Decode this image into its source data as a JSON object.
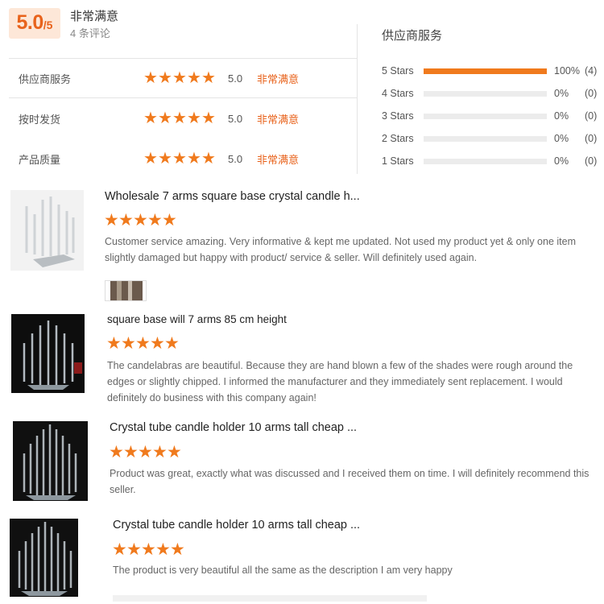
{
  "summary": {
    "score": "5.0",
    "score_max": "/5",
    "level_label": "非常满意",
    "review_count": "4 条评论"
  },
  "services": [
    {
      "name": "供应商服务",
      "score": "5.0",
      "level": "非常满意",
      "stars": 5
    },
    {
      "name": "按时发货",
      "score": "5.0",
      "level": "非常满意",
      "stars": 5
    },
    {
      "name": "产品质量",
      "score": "5.0",
      "level": "非常满意",
      "stars": 5
    }
  ],
  "distribution": {
    "title": "供应商服务",
    "rows": [
      {
        "label": "5 Stars",
        "fraction": 1.0,
        "pct": "100%",
        "count": "(4)"
      },
      {
        "label": "4 Stars",
        "fraction": 0.0,
        "pct": "0%",
        "count": "(0)"
      },
      {
        "label": "3 Stars",
        "fraction": 0.0,
        "pct": "0%",
        "count": "(0)"
      },
      {
        "label": "2 Stars",
        "fraction": 0.0,
        "pct": "0%",
        "count": "(0)"
      },
      {
        "label": "1 Stars",
        "fraction": 0.0,
        "pct": "0%",
        "count": "(0)"
      }
    ]
  },
  "reviews": [
    {
      "title": "Wholesale 7 arms square base crystal candle h...",
      "stars": 5,
      "text": "Customer service amazing. Very informative & kept me updated. Not used my product yet & only one item slightly damaged but happy with product/ service & seller. Will definitely used again.",
      "thumb": "product-photo-white-candelabra-icon",
      "has_photo": true
    },
    {
      "title": "square base will 7 arms 85 cm height",
      "stars": 5,
      "text": "The candelabras are beautiful.  Because they are hand blown a few of the shades were rough around the edges or slightly chipped.  I informed the manufacturer and they immediately sent replacement.  I would definitely do business with this company again!",
      "thumb": "product-photo-dark-candelabra-icon",
      "has_photo": false
    },
    {
      "title": "Crystal tube candle holder 10 arms tall cheap ...",
      "stars": 5,
      "text": "Product was great, exactly what was discussed and I received them on time. I will definitely recommend this seller.",
      "thumb": "product-photo-dark-candelabra-icon",
      "has_photo": false
    },
    {
      "title": "Crystal tube candle holder 10 arms tall cheap ...",
      "stars": 5,
      "text": "The product is very beautiful all the same as the description I am very happy",
      "thumb": "product-photo-dark-candelabra-icon",
      "has_photo": false
    }
  ],
  "colors": {
    "accent": "#f07a1d",
    "accent_bg": "#fde7d8",
    "bar_bg": "#ececec"
  },
  "icons": {
    "star": "star-icon"
  }
}
